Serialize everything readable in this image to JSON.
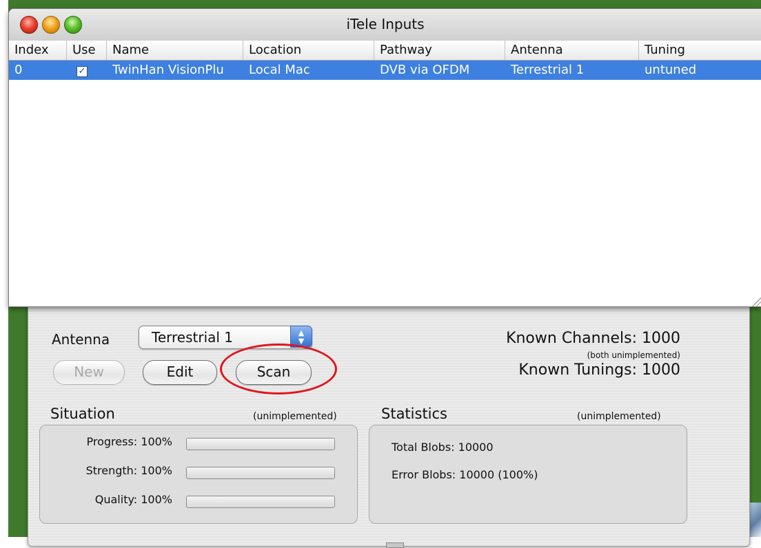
{
  "window": {
    "title": "iTele Inputs"
  },
  "table": {
    "columns": [
      "Index",
      "Use",
      "Name",
      "Location",
      "Pathway",
      "Antenna",
      "Tuning"
    ],
    "rows": [
      {
        "index": "0",
        "use": true,
        "use_mark": "✓",
        "name": "TwinHan VisionPlu",
        "location": "Local Mac",
        "pathway": "DVB via OFDM",
        "antenna": "Terrestrial 1",
        "tuning": "untuned"
      }
    ]
  },
  "controls": {
    "antenna_label": "Antenna",
    "antenna_selected": "Terrestrial 1",
    "popup_arrows": "▲\n▼",
    "new_label": "New",
    "edit_label": "Edit",
    "scan_label": "Scan",
    "known_channels": "Known Channels: 1000",
    "both_unimplemented": "(both unimplemented)",
    "known_tunings": "Known Tunings: 1000"
  },
  "situation": {
    "title": "Situation",
    "note": "(unimplemented)",
    "meters": [
      {
        "label": "Progress: 100%",
        "value": 1.0
      },
      {
        "label": "Strength: 100%",
        "value": 1.0
      },
      {
        "label": "Quality: 100%",
        "value": 1.0
      }
    ]
  },
  "statistics": {
    "title": "Statistics",
    "note": "(unimplemented)",
    "total_blobs": "Total Blobs: 10000",
    "error_blobs": "Error Blobs: 10000 (100%)"
  },
  "colors": {
    "selection": "#3d80df",
    "highlight_ring": "#e0151d",
    "desktop": "#3f7a2c"
  },
  "icons": [
    "close-button",
    "minimize-button",
    "zoom-button",
    "checkbox-checked-icon",
    "popup-arrows-icon",
    "resize-grip-icon"
  ]
}
